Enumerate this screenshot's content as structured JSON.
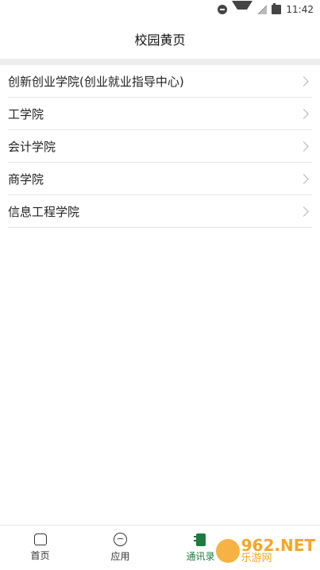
{
  "status_bar": {
    "time": "11:42"
  },
  "header": {
    "title": "校园黄页"
  },
  "list": {
    "items": [
      {
        "label": "创新创业学院(创业就业指导中心)"
      },
      {
        "label": "工学院"
      },
      {
        "label": "会计学院"
      },
      {
        "label": "商学院"
      },
      {
        "label": "信息工程学院"
      }
    ]
  },
  "tabbar": {
    "tabs": [
      {
        "label": "首页",
        "icon": "home-icon"
      },
      {
        "label": "应用",
        "icon": "apps-icon"
      },
      {
        "label": "通讯录",
        "icon": "contacts-icon",
        "active": true
      }
    ],
    "active_color": "#1f7a3d"
  },
  "watermark": {
    "top": "962.NET",
    "bottom": "乐游网"
  }
}
